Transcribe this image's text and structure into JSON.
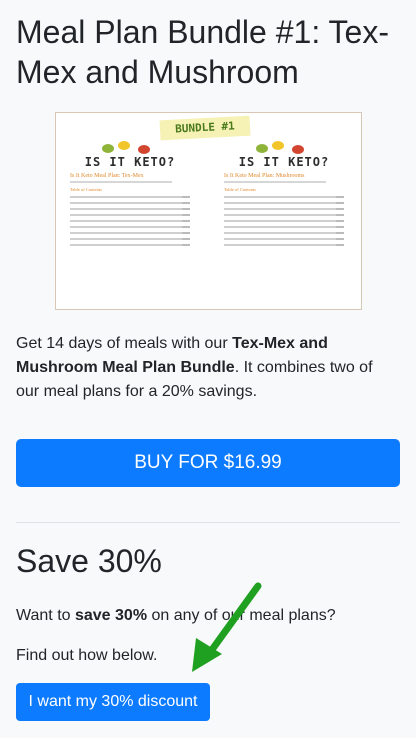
{
  "page": {
    "title": "Meal Plan Bundle #1: Tex-Mex and Mushroom"
  },
  "preview": {
    "badge": "BUNDLE #1",
    "left": {
      "logo": "IS IT KETO?",
      "heading": "Is It Keto Meal Plan: Tex-Mex",
      "toc_heading": "Table of Contents"
    },
    "right": {
      "logo": "IS IT KETO?",
      "heading": "Is It Keto Meal Plan: Mushrooms",
      "toc_heading": "Table of Contents"
    },
    "colors": {
      "avocado": "#8fb43a",
      "lemon": "#f2c62b",
      "pepper": "#d2452e",
      "accent_orange": "#e08a2e"
    }
  },
  "description": {
    "prefix": "Get 14 days of meals with our ",
    "bold": "Tex-Mex and Mushroom Meal Plan Bundle",
    "suffix": ". It combines two of our meal plans for a 20% savings."
  },
  "buy_button": {
    "label": "BUY FOR $16.99"
  },
  "save_section": {
    "heading": "Save 30%",
    "p1_prefix": "Want to ",
    "p1_bold": "save 30%",
    "p1_suffix": " on any of our meal plans?",
    "p2": "Find out how below.",
    "discount_button": "I want my 30% discount"
  },
  "theme": {
    "button_blue": "#0d7bff",
    "arrow_green": "#20a020"
  }
}
